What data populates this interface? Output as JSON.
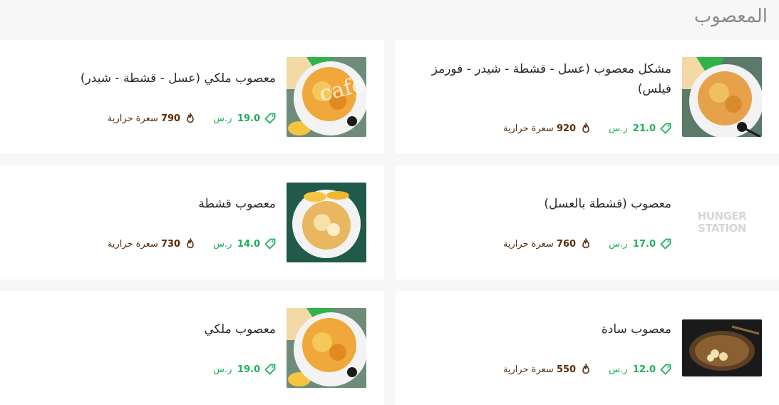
{
  "section": {
    "title": "المعصوب"
  },
  "currency": "ر.س",
  "calories_label": "سعرة حرارية",
  "watermark": "cafe",
  "placeholder_logo": [
    "HUNGER",
    "STATION"
  ],
  "colors": {
    "price": "#19b05c",
    "calories": "#5a2d0c",
    "card": "#ffffff",
    "background": "#f7f7f7"
  },
  "items": [
    {
      "name": "مشكل معصوب (عسل - قشطة - شيدر - فورمز فيلس)",
      "price": "21.0",
      "calories": "920",
      "image": "masoub-mix-plate"
    },
    {
      "name": "معصوب ملكي (عسل - قشطة - شيدر)",
      "price": "19.0",
      "calories": "790",
      "image": "masoub-royal-plate"
    },
    {
      "name": "معصوب (قشطة بالعسل)",
      "price": "17.0",
      "calories": "760",
      "image": "hungerstation-placeholder"
    },
    {
      "name": "معصوب قشطة",
      "price": "14.0",
      "calories": "730",
      "image": "masoub-cream-plate"
    },
    {
      "name": "معصوب سادة",
      "price": "12.0",
      "calories": "550",
      "image": "masoub-plain-plate"
    },
    {
      "name": "معصوب ملكي",
      "price": "19.0",
      "calories": "",
      "image": "masoub-royal-plate"
    }
  ]
}
